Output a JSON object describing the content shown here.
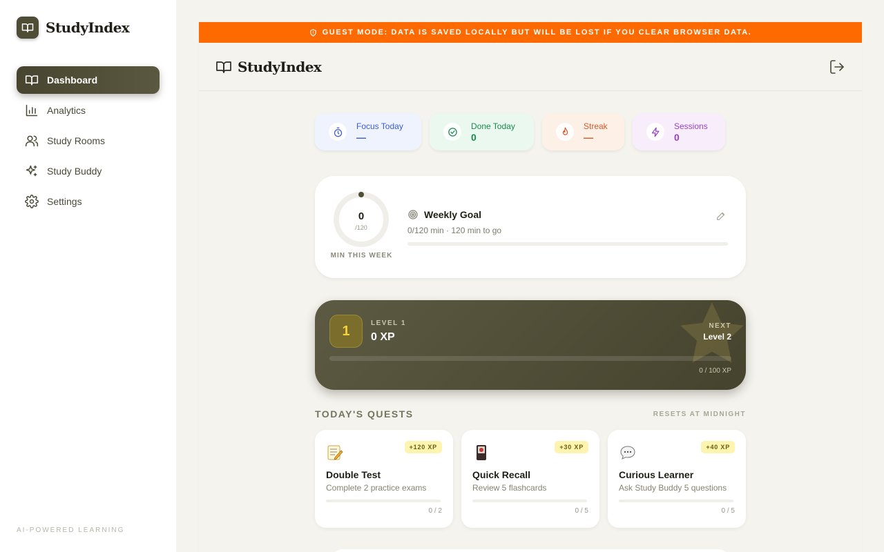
{
  "app": {
    "brand": "StudyIndex"
  },
  "sidebar": {
    "items": [
      {
        "label": "Dashboard",
        "icon": "book-open-icon",
        "active": true
      },
      {
        "label": "Analytics",
        "icon": "bar-chart-icon",
        "active": false
      },
      {
        "label": "Study Rooms",
        "icon": "users-icon",
        "active": false
      },
      {
        "label": "Study Buddy",
        "icon": "sparkles-icon",
        "active": false
      },
      {
        "label": "Settings",
        "icon": "gear-icon",
        "active": false
      }
    ],
    "footer": "AI-POWERED LEARNING"
  },
  "banner": {
    "text": "GUEST MODE: DATA IS SAVED LOCALLY BUT WILL BE LOST IF YOU CLEAR BROWSER DATA.",
    "color": "#ff6a00"
  },
  "header": {
    "brand": "StudyIndex",
    "logout_icon": "logout-icon"
  },
  "stats": [
    {
      "label": "Focus Today",
      "value": "—",
      "icon": "timer-icon",
      "bg": "#eef3fd",
      "fg": "#3b5bd9"
    },
    {
      "label": "Done Today",
      "value": "0",
      "icon": "check-circle-icon",
      "bg": "#ebf8ef",
      "fg": "#178a4c"
    },
    {
      "label": "Streak",
      "value": "—",
      "icon": "flame-icon",
      "bg": "#fdf1e7",
      "fg": "#d9582a"
    },
    {
      "label": "Sessions",
      "value": "0",
      "icon": "lightning-icon",
      "bg": "#f8eefb",
      "fg": "#9a3fc7"
    }
  ],
  "goal": {
    "ring_value": "0",
    "ring_total": "/120",
    "ring_caption": "MIN THIS WEEK",
    "title": "Weekly Goal",
    "subtitle": "0/120 min · 120 min to go",
    "progress": 0
  },
  "level": {
    "badge": "1",
    "label": "LEVEL 1",
    "xp": "0 XP",
    "next_label": "NEXT",
    "next_value": "Level 2",
    "progress_text": "0 / 100 XP",
    "progress": 0,
    "accent": "#f5d33a"
  },
  "quests": {
    "title": "TODAY'S QUESTS",
    "reset": "RESETS AT MIDNIGHT",
    "items": [
      {
        "icon": "memo-icon",
        "xp": "+120 XP",
        "name": "Double Test",
        "desc": "Complete 2 practice exams",
        "progress_text": "0 / 2",
        "progress": 0
      },
      {
        "icon": "flashcard-icon",
        "xp": "+30 XP",
        "name": "Quick Recall",
        "desc": "Review 5 flashcards",
        "progress_text": "0 / 5",
        "progress": 0
      },
      {
        "icon": "speech-bubble-icon",
        "xp": "+40 XP",
        "name": "Curious Learner",
        "desc": "Ask Study Buddy 5 questions",
        "progress_text": "0 / 5",
        "progress": 0
      }
    ]
  }
}
